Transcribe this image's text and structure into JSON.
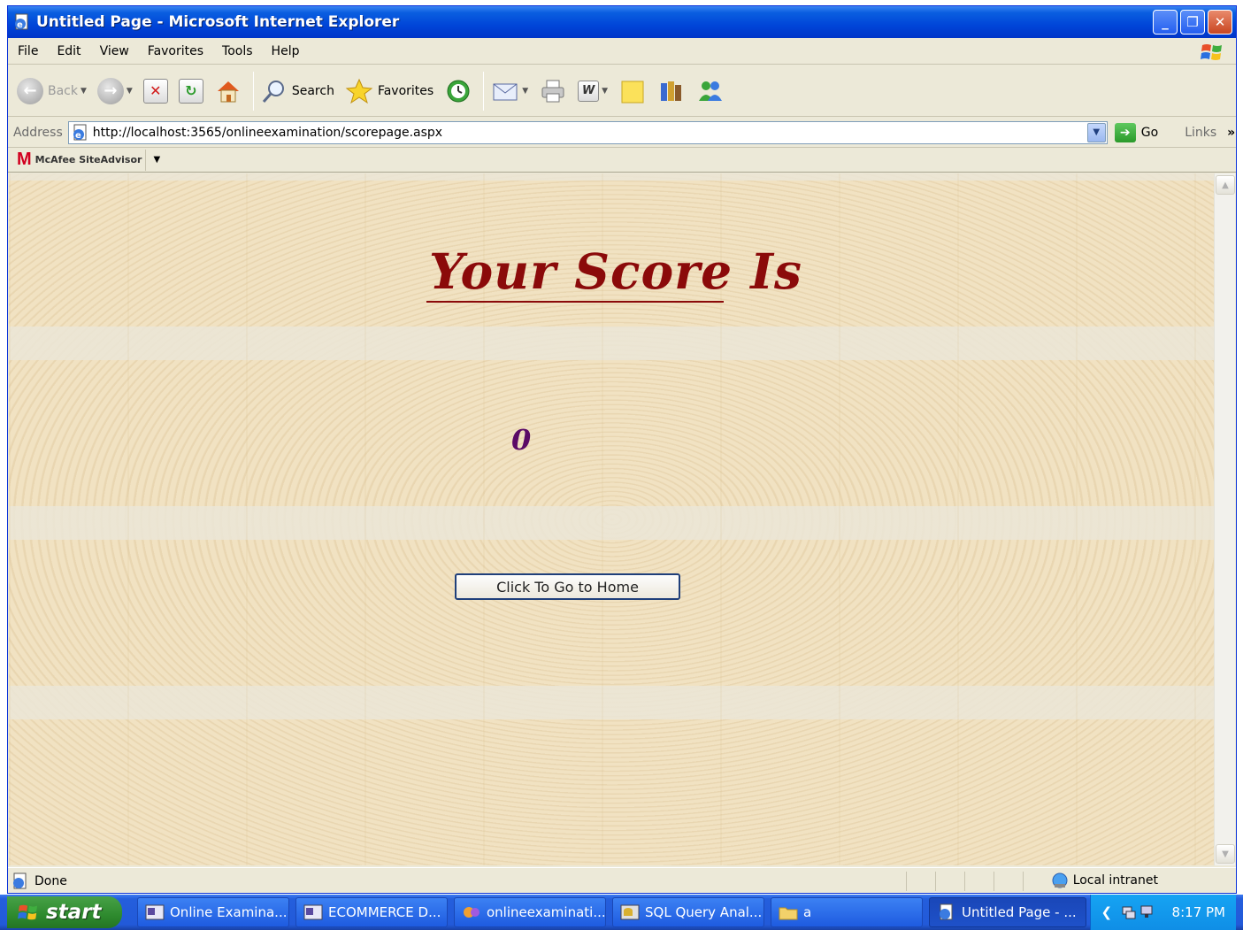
{
  "window": {
    "title": "Untitled Page - Microsoft Internet Explorer",
    "minimize": "_",
    "restore": "❐",
    "close": "✕"
  },
  "menu": [
    "File",
    "Edit",
    "View",
    "Favorites",
    "Tools",
    "Help"
  ],
  "toolbar": {
    "back_label": "Back",
    "search_label": "Search",
    "favorites_label": "Favorites"
  },
  "address": {
    "label": "Address",
    "url": "http://localhost:3565/onlineexamination/scorepage.aspx",
    "go_label": "Go",
    "links_label": "Links"
  },
  "sitebar": {
    "logo_letter": "M",
    "name": "McAfee SiteAdvisor"
  },
  "page": {
    "heading": "Your Score Is",
    "score": "0",
    "home_button": "Click To Go to Home"
  },
  "status": {
    "text": "Done",
    "zone": "Local intranet"
  },
  "taskbar": {
    "start_label": "start",
    "tasks": [
      {
        "label": "Online Examina..."
      },
      {
        "label": "ECOMMERCE D..."
      },
      {
        "label": "onlineexaminati..."
      },
      {
        "label": "SQL Query Anal..."
      },
      {
        "label": "a"
      },
      {
        "label": "Untitled Page - ..."
      }
    ],
    "clock": "8:17 PM"
  },
  "colors": {
    "heading": "#8b0a0a",
    "score": "#5a0a66",
    "titlebar": "#0045d8",
    "taskbar": "#245edc",
    "start": "#2e8a2e"
  }
}
